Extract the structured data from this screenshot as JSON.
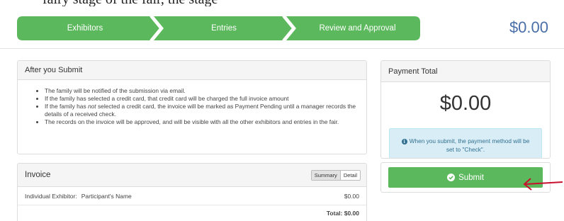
{
  "top_fragment": "fairy stage of the fair, the stage",
  "wizard": {
    "steps": [
      {
        "label": "Exhibitors"
      },
      {
        "label": "Entries"
      },
      {
        "label": "Review and Approval"
      }
    ],
    "total": "$0.00",
    "color": "#5cb85c"
  },
  "after_submit": {
    "title": "After you Submit",
    "items": [
      "The family will be notified of the submission via email.",
      "If the family has selected a credit card, that credit card will be charged the full invoice amount",
      {
        "before": "If the family has ",
        "emphasis": "not",
        "after": " selected a credit card, the invoice will be marked as Payment Pending until a manager records the details of a received check."
      },
      "The records on the invoice will be approved, and will be visible with all the other exhibitors and entries in the fair."
    ]
  },
  "invoice": {
    "title": "Invoice",
    "toggle": {
      "summary": "Summary",
      "detail": "Detail",
      "active": "summary"
    },
    "rows": [
      {
        "label": "Individual Exhibitor:",
        "name": "Participant's Name",
        "amount": "$0.00"
      }
    ],
    "total": "Total: $0.00"
  },
  "payment": {
    "title": "Payment Total",
    "amount": "$0.00",
    "info_icon": "info-circle-icon",
    "info": "When you submit, the payment method will be set to \"Check\".",
    "submit_label": "Submit",
    "submit_icon": "check-circle-icon"
  },
  "annotation": {
    "icon": "arrow-left-icon",
    "color": "#c8102e"
  }
}
